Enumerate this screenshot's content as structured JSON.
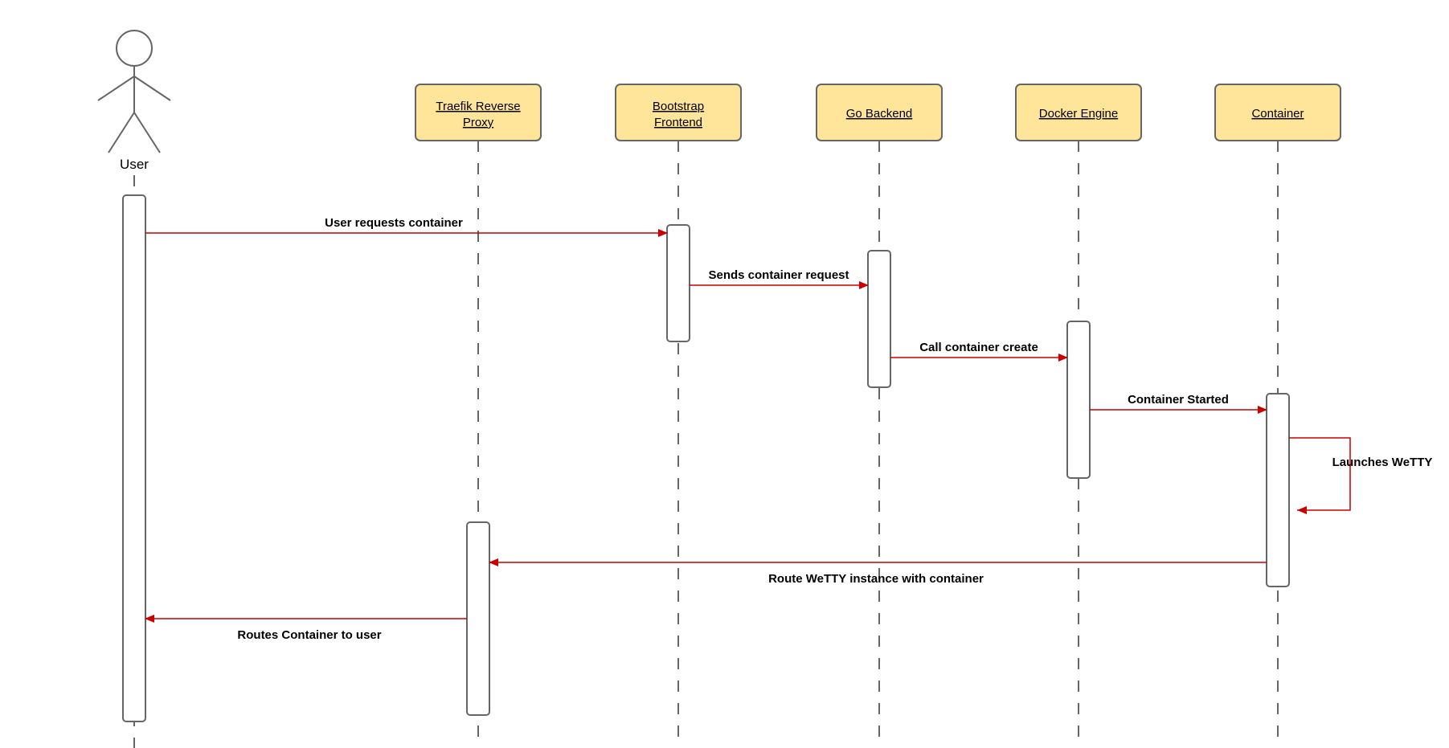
{
  "actor": {
    "label": "User"
  },
  "participants": {
    "traefik": {
      "label1": "Traefik Reverse",
      "label2": "Proxy"
    },
    "bootstrap": {
      "label1": "Bootstrap",
      "label2": "Frontend"
    },
    "gobackend": {
      "label1": "Go Backend",
      "label2": ""
    },
    "docker": {
      "label1": "Docker Engine",
      "label2": ""
    },
    "container": {
      "label1": "Container",
      "label2": ""
    }
  },
  "messages": {
    "m1": "User requests container",
    "m2": "Sends container request",
    "m3": "Call container create",
    "m4": "Container Started",
    "m5": "Launches WeTTY",
    "m6": "Route WeTTY instance with container",
    "m7": "Routes Container to user"
  }
}
